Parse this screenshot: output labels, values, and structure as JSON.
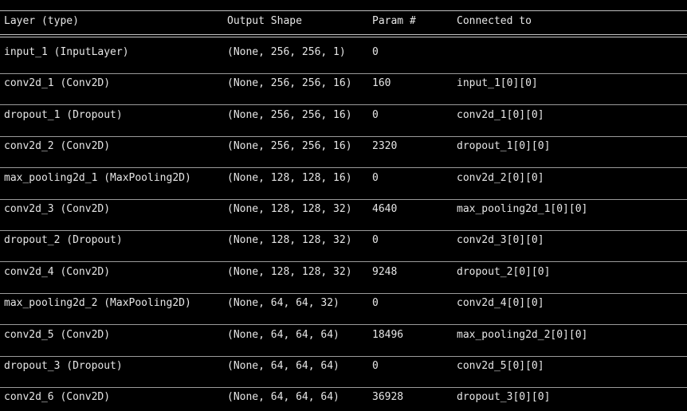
{
  "summary": {
    "columns": [
      "Layer (type)",
      "Output Shape",
      "Param #",
      "Connected to"
    ],
    "rows": [
      {
        "layer": "input_1 (InputLayer)",
        "shape": "(None, 256, 256, 1)",
        "params": "0",
        "connected": ""
      },
      {
        "layer": "conv2d_1 (Conv2D)",
        "shape": "(None, 256, 256, 16)",
        "params": "160",
        "connected": "input_1[0][0]"
      },
      {
        "layer": "dropout_1 (Dropout)",
        "shape": "(None, 256, 256, 16)",
        "params": "0",
        "connected": "conv2d_1[0][0]"
      },
      {
        "layer": "conv2d_2 (Conv2D)",
        "shape": "(None, 256, 256, 16)",
        "params": "2320",
        "connected": "dropout_1[0][0]"
      },
      {
        "layer": "max_pooling2d_1 (MaxPooling2D)",
        "shape": "(None, 128, 128, 16)",
        "params": "0",
        "connected": "conv2d_2[0][0]"
      },
      {
        "layer": "conv2d_3 (Conv2D)",
        "shape": "(None, 128, 128, 32)",
        "params": "4640",
        "connected": "max_pooling2d_1[0][0]"
      },
      {
        "layer": "dropout_2 (Dropout)",
        "shape": "(None, 128, 128, 32)",
        "params": "0",
        "connected": "conv2d_3[0][0]"
      },
      {
        "layer": "conv2d_4 (Conv2D)",
        "shape": "(None, 128, 128, 32)",
        "params": "9248",
        "connected": "dropout_2[0][0]"
      },
      {
        "layer": "max_pooling2d_2 (MaxPooling2D)",
        "shape": "(None, 64, 64, 32)",
        "params": "0",
        "connected": "conv2d_4[0][0]"
      },
      {
        "layer": "conv2d_5 (Conv2D)",
        "shape": "(None, 64, 64, 64)",
        "params": "18496",
        "connected": "max_pooling2d_2[0][0]"
      },
      {
        "layer": "dropout_3 (Dropout)",
        "shape": "(None, 64, 64, 64)",
        "params": "0",
        "connected": "conv2d_5[0][0]"
      },
      {
        "layer": "conv2d_6 (Conv2D)",
        "shape": "(None, 64, 64, 64)",
        "params": "36928",
        "connected": "dropout_3[0][0]"
      }
    ]
  },
  "colors": {
    "background": "#000000",
    "text": "#e6e6e6",
    "rule": "#9a9a9a"
  }
}
